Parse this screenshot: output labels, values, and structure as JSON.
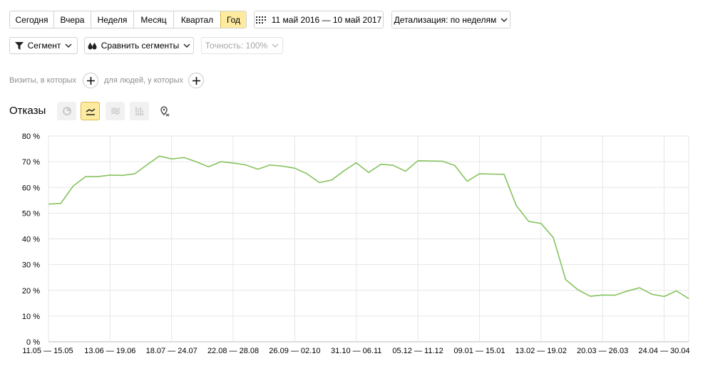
{
  "period": {
    "buttons": [
      "Сегодня",
      "Вчера",
      "Неделя",
      "Месяц",
      "Квартал",
      "Год"
    ],
    "active_index": 5,
    "date_range": "11 май 2016 — 10 май 2017",
    "detail_label": "Детализация: по неделям"
  },
  "segments": {
    "segment_label": "Сегмент",
    "compare_label": "Сравнить сегменты",
    "accuracy_label": "Точность: 100%"
  },
  "filters": {
    "visits_label": "Визиты, в которых",
    "people_label": "для людей, у которых"
  },
  "chart_header": {
    "title": "Отказы",
    "view_buttons": [
      "pie-chart-icon",
      "line-chart-icon",
      "stacked-area-icon",
      "bar-chart-icon",
      "map-icon"
    ],
    "active_view": 1
  },
  "accent_color": "#ffeba0",
  "line_color": "#86c35f",
  "chart_data": {
    "type": "line",
    "title": "Отказы",
    "xlabel": "",
    "ylabel": "",
    "ylim": [
      0,
      80
    ],
    "y_ticks": [
      "0 %",
      "10 %",
      "20 %",
      "30 %",
      "40 %",
      "50 %",
      "60 %",
      "70 %",
      "80 %"
    ],
    "x_tick_labels": [
      "11.05 — 15.05",
      "13.06 — 19.06",
      "18.07 — 24.07",
      "22.08 — 28.08",
      "26.09 — 02.10",
      "31.10 — 06.11",
      "05.12 — 11.12",
      "09.01 — 15.01",
      "13.02 — 19.02",
      "20.03 — 26.03",
      "24.04 — 30.04"
    ],
    "x_tick_index": [
      0,
      5,
      10,
      15,
      20,
      25,
      30,
      35,
      40,
      45,
      50
    ],
    "grid": true,
    "series": [
      {
        "values": [
          53.5,
          53.8,
          60.5,
          64.2,
          64.2,
          64.8,
          64.7,
          65.3,
          68.8,
          72.2,
          71.1,
          71.6,
          70.0,
          68.0,
          70.0,
          69.5,
          68.8,
          67.1,
          68.7,
          68.3,
          67.5,
          65.3,
          61.9,
          62.9,
          66.5,
          69.6,
          65.8,
          69.0,
          68.6,
          66.3,
          70.4,
          70.3,
          70.2,
          68.5,
          62.4,
          65.3,
          65.2,
          65.1,
          52.9,
          46.8,
          46.0,
          40.5,
          24.2,
          20.2,
          17.7,
          18.2,
          18.1,
          19.7,
          21.0,
          18.5,
          17.6,
          19.8,
          16.8
        ]
      }
    ]
  }
}
